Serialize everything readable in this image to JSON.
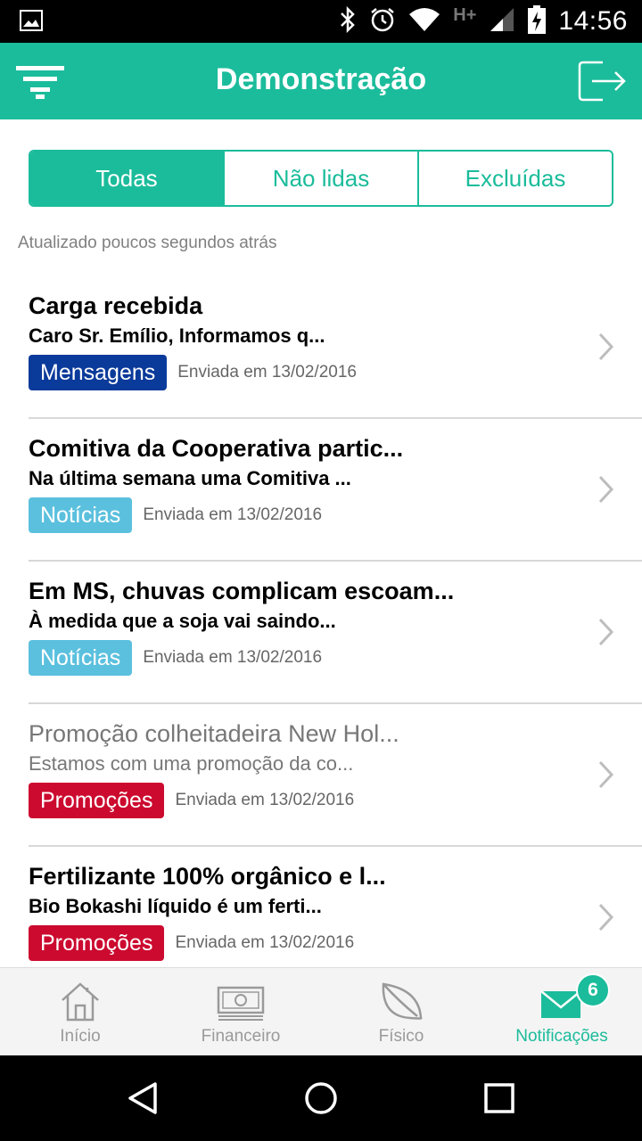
{
  "status_bar": {
    "time": "14:56",
    "network": "H+"
  },
  "app_bar": {
    "title": "Demonstração"
  },
  "segments": [
    {
      "label": "Todas",
      "active": true
    },
    {
      "label": "Não lidas",
      "active": false
    },
    {
      "label": "Excluídas",
      "active": false
    }
  ],
  "updated_text": "Atualizado poucos segundos atrás",
  "notifications": [
    {
      "title": "Carga recebida",
      "preview": "Caro Sr. Emílio, Informamos q...",
      "category": "Mensagens",
      "category_color": "#0a3a9a",
      "sent": "Enviada em 13/02/2016",
      "read": false
    },
    {
      "title": "Comitiva da Cooperativa partic...",
      "preview": "Na última semana uma Comitiva ...",
      "category": "Notícias",
      "category_color": "#5bc0de",
      "sent": "Enviada em 13/02/2016",
      "read": false
    },
    {
      "title": "Em MS, chuvas complicam escoam...",
      "preview": "À medida que a soja vai saindo...",
      "category": "Notícias",
      "category_color": "#5bc0de",
      "sent": "Enviada em 13/02/2016",
      "read": false
    },
    {
      "title": "Promoção colheitadeira New Hol...",
      "preview": "Estamos com uma promoção da co...",
      "category": "Promoções",
      "category_color": "#cc0a2f",
      "sent": "Enviada em 13/02/2016",
      "read": true
    },
    {
      "title": "Fertilizante 100% orgânico e l...",
      "preview": "Bio Bokashi líquido é um ferti...",
      "category": "Promoções",
      "category_color": "#cc0a2f",
      "sent": "Enviada em 13/02/2016",
      "read": false
    }
  ],
  "tabbar": {
    "items": [
      {
        "label": "Início",
        "icon": "house-icon",
        "active": false
      },
      {
        "label": "Financeiro",
        "icon": "banknote-icon",
        "active": false
      },
      {
        "label": "Físico",
        "icon": "leaf-icon",
        "active": false
      },
      {
        "label": "Notificações",
        "icon": "envelope-icon",
        "active": true
      }
    ],
    "notification_count": "6"
  },
  "colors": {
    "accent": "#1bbc9b",
    "inactive": "#9a9a9a"
  }
}
